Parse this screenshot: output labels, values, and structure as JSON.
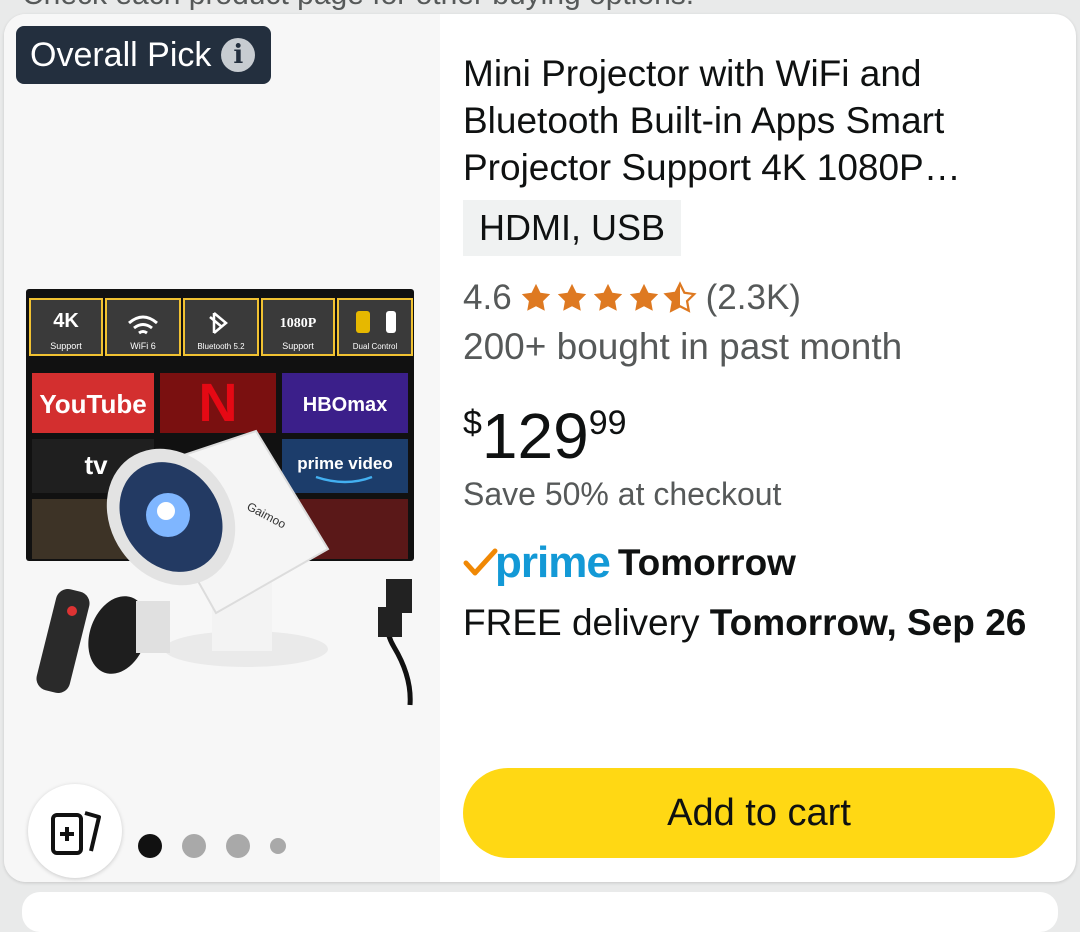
{
  "top_note": "Check each product page for other buying options.",
  "badge": {
    "label": "Overall Pick"
  },
  "product": {
    "title": "Mini Projector with WiFi and Bluetooth Built-in Apps Smart Projector Support 4K 1080P…",
    "variant": "HDMI, USB",
    "rating": "4.6",
    "rating_value": 4.6,
    "review_count": "(2.3K)",
    "bought": "200+ bought in past month",
    "price_symbol": "$",
    "price_whole": "129",
    "price_fraction": "99",
    "save_text": "Save 50% at checkout",
    "prime_label": "prime",
    "prime_day": "Tomorrow",
    "delivery_prefix": "FREE delivery ",
    "delivery_date": "Tomorrow, Sep 26",
    "add_to_cart": "Add to cart"
  },
  "image_labels": {
    "spec_4k": "4K",
    "spec_4k_sub": "Support",
    "spec_wifi_sub": "WiFi 6",
    "spec_bt_sub": "Bluetooth 5.2",
    "spec_1080": "1080P",
    "spec_1080_sub": "Support",
    "spec_dual_sub": "Dual Control",
    "app_youtube": "YouTube",
    "app_hbo": "HBOmax",
    "app_tv": "tv",
    "app_prime": "prime video",
    "brand": "Gaimoo"
  },
  "carousel": {
    "count": 4,
    "active": 0
  },
  "colors": {
    "accent": "#ffd814",
    "prime": "#1399d6",
    "star": "#de7921",
    "badge": "#232f3e"
  }
}
